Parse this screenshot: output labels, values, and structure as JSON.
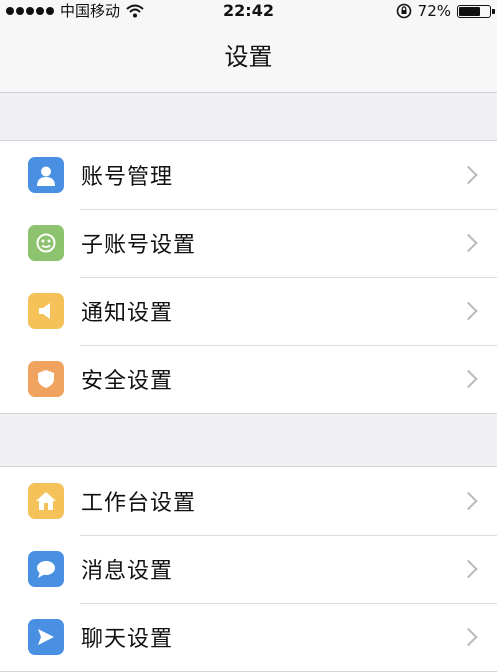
{
  "status_bar": {
    "carrier": "中国移动",
    "time": "22:42",
    "battery_percent": "72%",
    "battery_level": 0.72
  },
  "nav": {
    "title": "设置"
  },
  "groups": [
    {
      "items": [
        {
          "label": "账号管理",
          "icon": "account-icon",
          "color": "#4a90e2"
        },
        {
          "label": "子账号设置",
          "icon": "sub-account-icon",
          "color": "#8dc26f"
        },
        {
          "label": "通知设置",
          "icon": "speaker-icon",
          "color": "#f5c25a"
        },
        {
          "label": "安全设置",
          "icon": "shield-icon",
          "color": "#f0a35e"
        }
      ]
    },
    {
      "items": [
        {
          "label": "工作台设置",
          "icon": "home-icon",
          "color": "#f5c25a"
        },
        {
          "label": "消息设置",
          "icon": "chat-bubble-icon",
          "color": "#4a90e2"
        },
        {
          "label": "聊天设置",
          "icon": "send-icon",
          "color": "#4a90e2"
        }
      ]
    }
  ]
}
